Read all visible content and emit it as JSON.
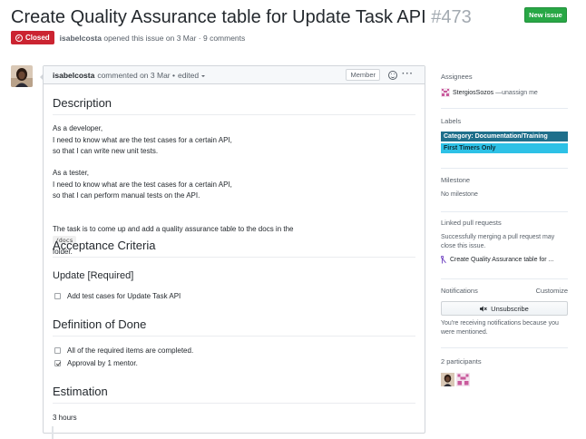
{
  "issue": {
    "title": "Create Quality Assurance table for Update Task API",
    "number": "#473",
    "state": "Closed",
    "author": "isabelcosta",
    "meta": "opened this issue on 3 Mar · 9 comments",
    "new_issue_label": "New issue"
  },
  "comment": {
    "author": "isabelcosta",
    "meta": "commented on 3 Mar •",
    "edited": "edited",
    "member_label": "Member",
    "sections": {
      "description": "Description",
      "dev_story": "As a developer,\nI need to know what are the test cases for a certain API,\nso that I can write new unit tests.",
      "tester_story": "As a tester,\nI need to know what are the test cases for a certain API,\nso that I can perform manual tests on the API.",
      "task_before": "The task is to come up and add a quality assurance table to the docs in the",
      "task_code": "/docs",
      "task_after": "folder.",
      "acceptance": "Acceptance Criteria",
      "update_required": "Update [Required]",
      "task_item": "Add test cases for Update Task API",
      "dod": "Definition of Done",
      "dod_items": [
        {
          "text": "All of the required items are completed.",
          "checked": false
        },
        {
          "text": "Approval by 1 mentor.",
          "checked": true
        }
      ],
      "estimation": "Estimation",
      "estimation_value": "3 hours"
    }
  },
  "sidebar": {
    "assignees_head": "Assignees",
    "assignee": "StergiosSozos",
    "unassign": "—unassign me",
    "labels_head": "Labels",
    "labels": [
      {
        "text": "Category: Documentation/Training",
        "bg": "#1f6f8b",
        "fg": "#ffffff"
      },
      {
        "text": "First Timers Only",
        "bg": "#2dc1e6",
        "fg": "#0b2a33"
      }
    ],
    "milestone_head": "Milestone",
    "milestone_value": "No milestone",
    "linked_head": "Linked pull requests",
    "linked_text": "Successfully merging a pull request may close this issue.",
    "linked_pr": "Create Quality Assurance table for ...",
    "notifications_head": "Notifications",
    "customize": "Customize",
    "unsubscribe": "Unsubscribe",
    "notif_text": "You're receiving notifications because you were mentioned.",
    "participants": "2 participants"
  },
  "colors": {
    "closed": "#cb2431",
    "new_issue": "#28a745",
    "pr_icon": "#6f42c1"
  }
}
